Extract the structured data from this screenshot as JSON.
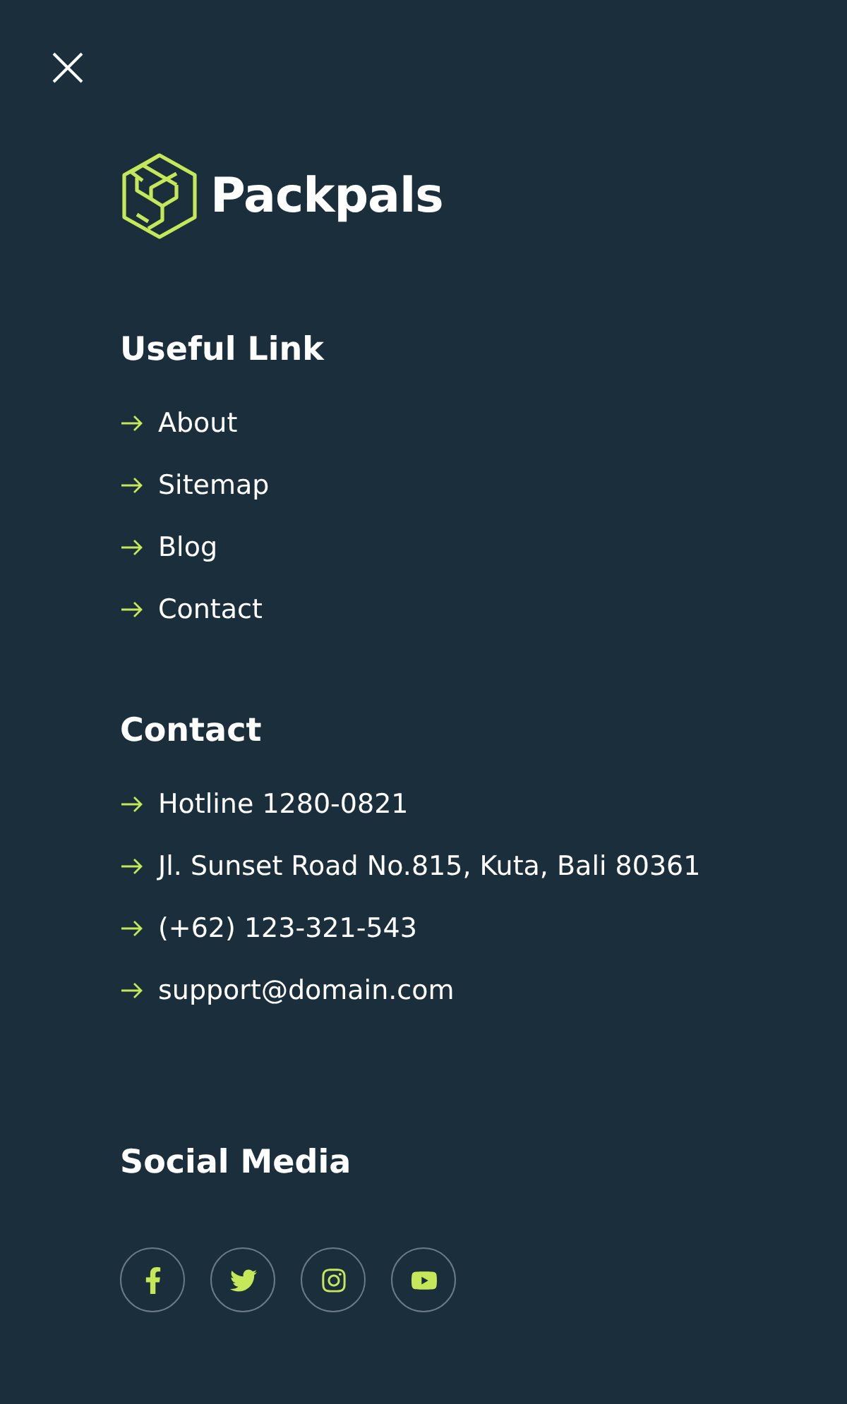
{
  "brand": {
    "name": "Packpals"
  },
  "sections": [
    {
      "title": "Useful Link",
      "items": [
        "About",
        "Sitemap",
        "Blog",
        "Contact"
      ]
    },
    {
      "title": "Contact",
      "items": [
        "Hotline 1280-0821",
        "Jl. Sunset Road No.815, Kuta, Bali 80361",
        "(+62) 123-321-543",
        "support@domain.com"
      ]
    }
  ],
  "social": {
    "title": "Social Media",
    "links": [
      {
        "kind": "facebook"
      },
      {
        "kind": "twitter"
      },
      {
        "kind": "instagram"
      },
      {
        "kind": "youtube"
      }
    ]
  }
}
